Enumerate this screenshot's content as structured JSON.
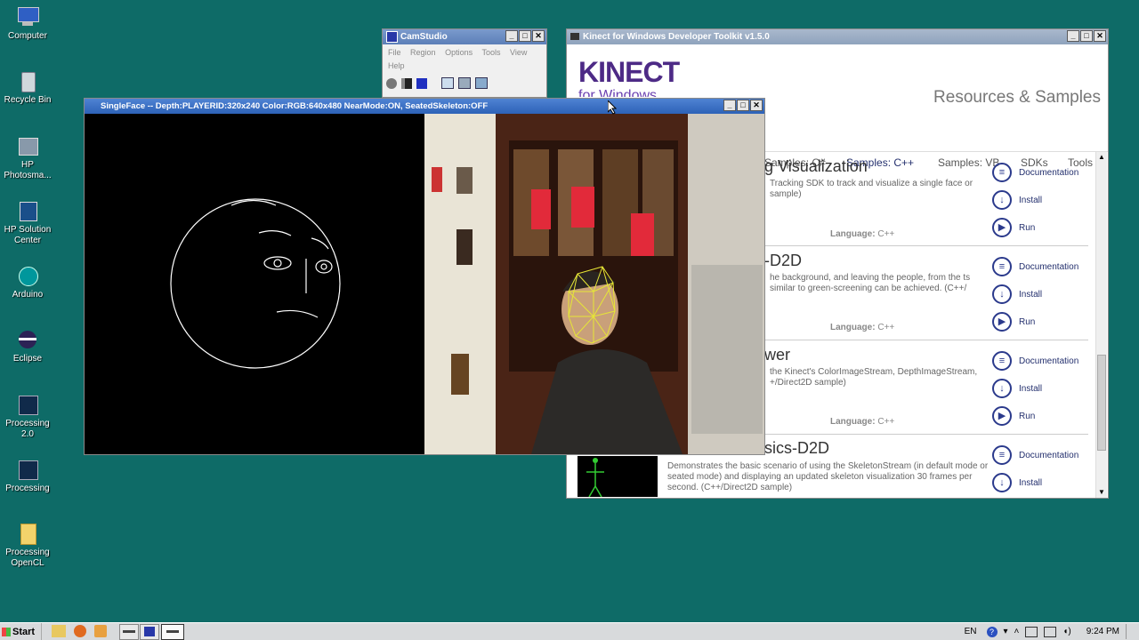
{
  "desktop_icons": [
    {
      "label": "Computer",
      "icon": "computer-icon"
    },
    {
      "label": "Recycle Bin",
      "icon": "recycle-bin-icon"
    },
    {
      "label": "HP Photosma...",
      "icon": "hp-photosmart-icon"
    },
    {
      "label": "HP Solution Center",
      "icon": "hp-solution-center-icon"
    },
    {
      "label": "Arduino",
      "icon": "arduino-icon"
    },
    {
      "label": "Eclipse",
      "icon": "eclipse-icon"
    },
    {
      "label": "Processing 2.0",
      "icon": "processing-icon"
    },
    {
      "label": "Processing",
      "icon": "processing-icon"
    },
    {
      "label": "Processing OpenCL",
      "icon": "folder-icon"
    }
  ],
  "camstudio": {
    "title": "CamStudio",
    "menu": [
      "File",
      "Region",
      "Options",
      "Tools",
      "View",
      "Help"
    ]
  },
  "kinect": {
    "title": "Kinect for Windows Developer Toolkit v1.5.0",
    "logo": "KINECT",
    "logo_sub": "for Windows",
    "heading": "Resources & Samples",
    "tabs": [
      "Samples: C#",
      "Samples: C++",
      "Samples: VB",
      "SDKs",
      "Tools"
    ],
    "active_tab": "Samples: C++",
    "lang_label": "Language:",
    "samples": [
      {
        "title": "g Visualization",
        "desc": "Tracking SDK to track and visualize a single face or sample)",
        "lang": "C++",
        "actions": [
          "Documentation",
          "Install",
          "Run"
        ]
      },
      {
        "title": "-D2D",
        "desc": "he background, and leaving the people, from the ts similar to green-screening can be achieved. (C++/",
        "lang": "C++",
        "actions": [
          "Documentation",
          "Install",
          "Run"
        ]
      },
      {
        "title": "wer",
        "desc": "the Kinect's ColorImageStream, DepthImageStream, +/Direct2D sample)",
        "lang": "C++",
        "actions": [
          "Documentation",
          "Install",
          "Run"
        ]
      },
      {
        "title": "sics-D2D",
        "desc": "Demonstrates the basic scenario of using the SkeletonStream (in default mode or seated mode) and displaying an updated skeleton visualization 30 frames per second. (C++/Direct2D sample)",
        "lang": "",
        "actions": [
          "Documentation",
          "Install"
        ]
      }
    ]
  },
  "singleface": {
    "title": "SingleFace -- Depth:PLAYERID:320x240 Color:RGB:640x480 NearMode:ON, SeatedSkeleton:OFF"
  },
  "taskbar": {
    "start": "Start",
    "lang": "EN",
    "time": "9:24 PM"
  }
}
